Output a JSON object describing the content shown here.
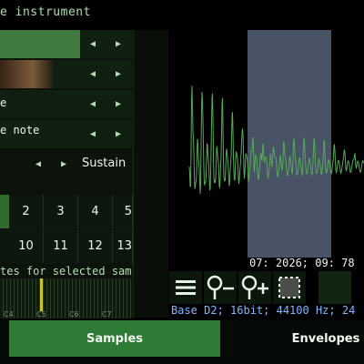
{
  "header": {
    "title": "e instrument"
  },
  "params": {
    "rows": [
      {
        "label": ""
      },
      {
        "label": ""
      },
      {
        "label": "e"
      },
      {
        "label": "e note"
      },
      {
        "label": ""
      }
    ],
    "arrow_left": "◀",
    "arrow_right": "▶",
    "sustain_label": "Sustain"
  },
  "sample_numbers": {
    "row1": [
      "",
      "2",
      "3",
      "4",
      "5"
    ],
    "row2": [
      "",
      "10",
      "11",
      "12",
      "13"
    ],
    "selected": 0
  },
  "notes_label": "tes for selected sam",
  "keyboard": {
    "octave_labels": [
      "C4",
      "C5",
      "C6",
      "C7"
    ]
  },
  "waveform": {
    "position_readout": "07: 2026; 09: 78",
    "status": "Base D2; 16bit; 44100 Hz; 24"
  },
  "toolbar": {
    "menu_icon": "menu-icon",
    "zoom_out_icon": "zoom-out-icon",
    "zoom_in_icon": "zoom-in-icon",
    "select_all_icon": "select-icon"
  },
  "tabs": {
    "samples": "Samples",
    "envelopes": "Envelopes",
    "active": "samples"
  },
  "colors": {
    "accent": "#2f7a35",
    "wave": "#57a85a",
    "selection": "#a0b9e1",
    "status": "#7fb8ff"
  }
}
